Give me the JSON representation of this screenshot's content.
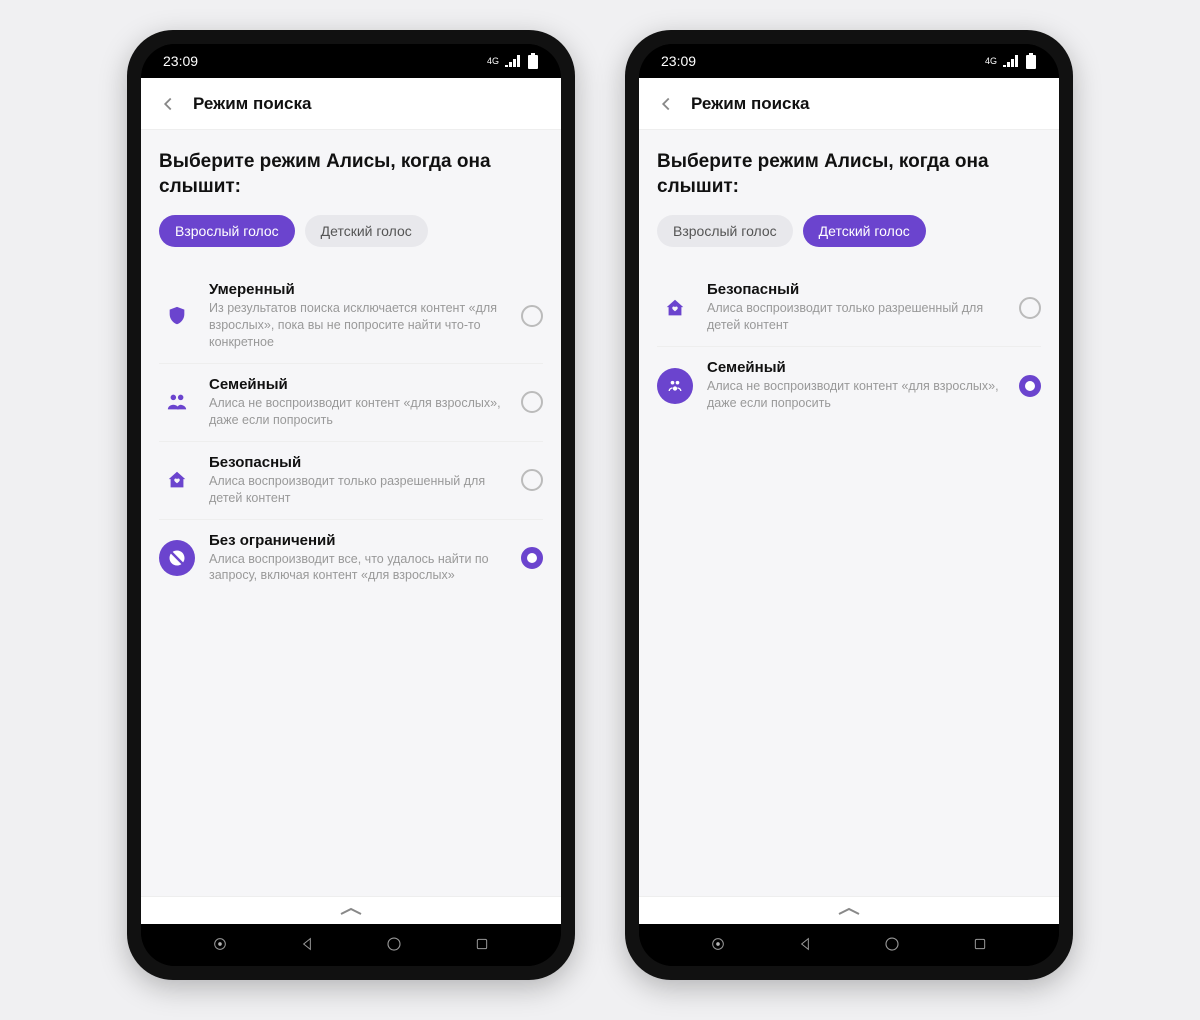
{
  "colors": {
    "accent": "#6b44ce"
  },
  "status": {
    "time": "23:09",
    "network_label": "4G"
  },
  "header": {
    "title": "Режим поиска"
  },
  "heading": "Выберите режим Алисы, когда она слышит:",
  "pills": {
    "adult": "Взрослый голос",
    "child": "Детский голос"
  },
  "phones": [
    {
      "active_pill": "adult",
      "options": [
        {
          "key": "moderate",
          "icon": "shield-icon",
          "style": "outline",
          "title": "Умеренный",
          "desc": "Из результатов поиска исключается контент «для взрослых», пока вы не попросите найти что-то конкретное",
          "checked": false
        },
        {
          "key": "family",
          "icon": "people-icon",
          "style": "outline",
          "title": "Семейный",
          "desc": "Алиса не воспроизводит контент «для взрослых», даже если попросить",
          "checked": false
        },
        {
          "key": "safe",
          "icon": "house-heart-icon",
          "style": "outline",
          "title": "Безопасный",
          "desc": "Алиса воспроизводит только разрешенный для детей контент",
          "checked": false
        },
        {
          "key": "unrestricted",
          "icon": "globe-off-icon",
          "style": "solid",
          "title": "Без ограничений",
          "desc": "Алиса воспроизводит все, что удалось найти по запросу, включая контент «для взрослых»",
          "checked": true
        }
      ]
    },
    {
      "active_pill": "child",
      "options": [
        {
          "key": "safe",
          "icon": "house-heart-icon",
          "style": "outline",
          "title": "Безопасный",
          "desc": "Алиса воспроизводит только разрешенный для детей контент",
          "checked": false
        },
        {
          "key": "family",
          "icon": "family-circle-icon",
          "style": "solid",
          "title": "Семейный",
          "desc": "Алиса не воспроизводит контент «для взрослых», даже если попросить",
          "checked": true
        }
      ]
    }
  ]
}
